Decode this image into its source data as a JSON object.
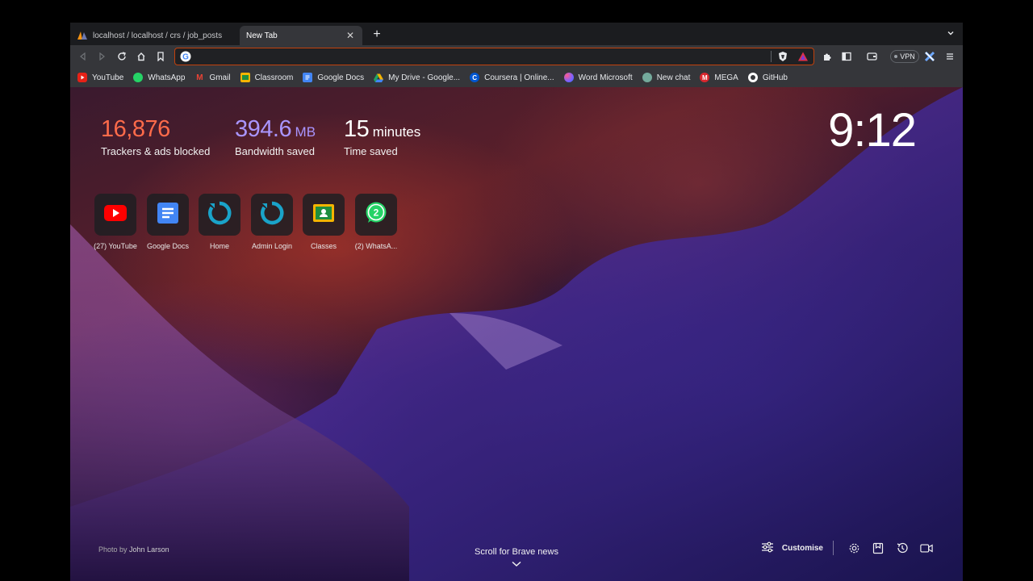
{
  "tabs": [
    {
      "title": "localhost / localhost / crs / job_posts",
      "active": false
    },
    {
      "title": "New Tab",
      "active": true
    }
  ],
  "omnibox": {
    "value": "",
    "placeholder": ""
  },
  "vpn": {
    "label": "VPN"
  },
  "bookmarks": [
    {
      "label": "YouTube",
      "icon": "youtube-icon",
      "color": "#e62117"
    },
    {
      "label": "WhatsApp",
      "icon": "whatsapp-icon",
      "color": "#25d366"
    },
    {
      "label": "Gmail",
      "icon": "gmail-icon",
      "color": "#ea4335"
    },
    {
      "label": "Classroom",
      "icon": "classroom-icon",
      "color": "#f5b400"
    },
    {
      "label": "Google Docs",
      "icon": "docs-icon",
      "color": "#4285f4"
    },
    {
      "label": "My Drive - Google...",
      "icon": "drive-icon",
      "color": "#1fa463"
    },
    {
      "label": "Coursera | Online...",
      "icon": "coursera-icon",
      "color": "#0056d2"
    },
    {
      "label": "Word Microsoft",
      "icon": "word-icon",
      "color": "#7b61ff"
    },
    {
      "label": "New chat",
      "icon": "chatgpt-icon",
      "color": "#74aa9c"
    },
    {
      "label": "MEGA",
      "icon": "mega-icon",
      "color": "#d9272e"
    },
    {
      "label": "GitHub",
      "icon": "github-icon",
      "color": "#ffffff"
    }
  ],
  "stats": {
    "trackers": {
      "value": "16,876",
      "label": "Trackers & ads blocked"
    },
    "bandwidth": {
      "value": "394.6",
      "unit": "MB",
      "label": "Bandwidth saved"
    },
    "time": {
      "value": "15",
      "unit": "minutes",
      "label": "Time saved"
    }
  },
  "clock": "9:12",
  "top_sites": [
    {
      "label": "(27) YouTube",
      "icon": "youtube-icon"
    },
    {
      "label": "Google Docs",
      "icon": "docs-icon"
    },
    {
      "label": "Home",
      "icon": "refresh-logo-icon"
    },
    {
      "label": "Admin Login",
      "icon": "refresh-logo-icon"
    },
    {
      "label": "Classes",
      "icon": "classroom-icon"
    },
    {
      "label": "(2) WhatsA...",
      "icon": "whatsapp-icon"
    }
  ],
  "photo_credit": {
    "prefix": "Photo by",
    "name": "John Larson"
  },
  "scroll_news": "Scroll for Brave news",
  "customise": "Customise",
  "colors": {
    "trackers": "#ff6b4a",
    "bandwidth": "#a995ff",
    "omnibox_border": "#c2410c"
  }
}
